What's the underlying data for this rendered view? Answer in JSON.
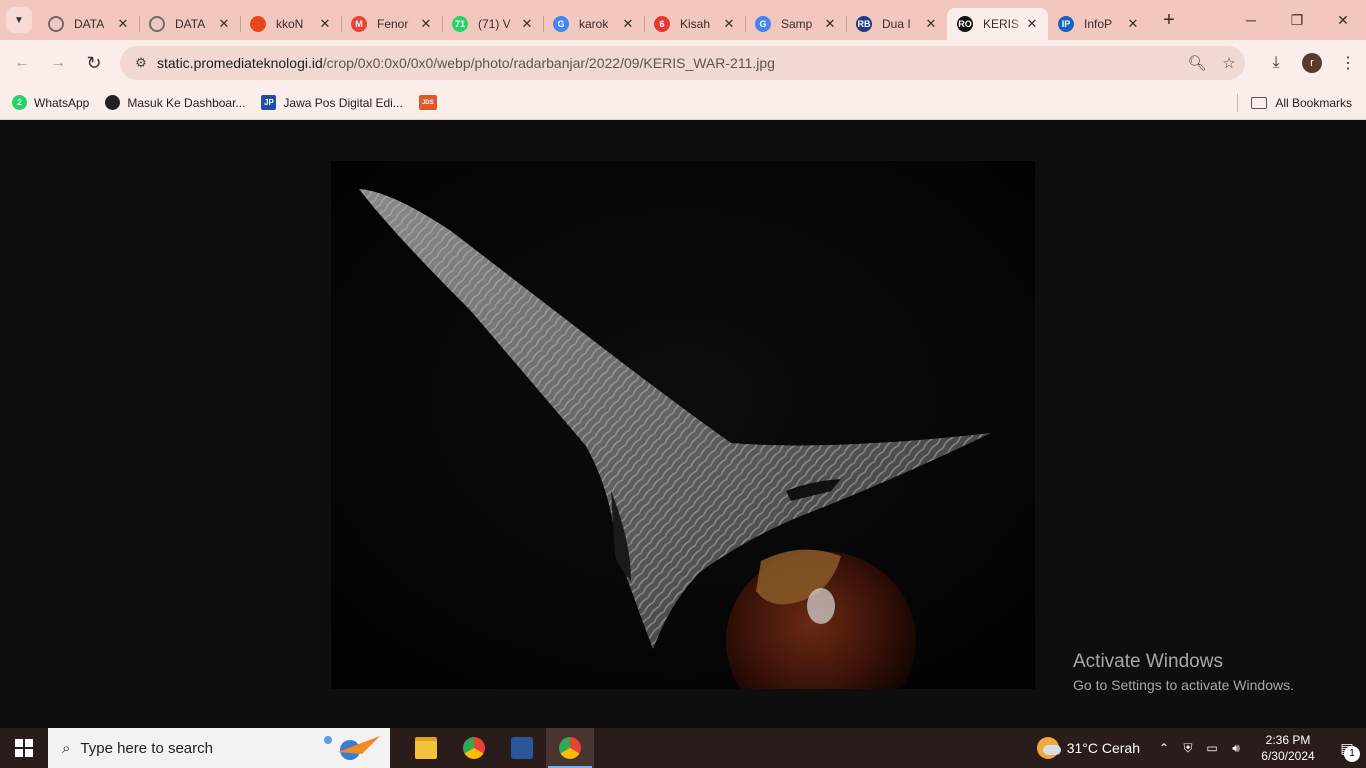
{
  "browser": {
    "tabs": [
      {
        "title": "DATA",
        "icon": "globe-icon",
        "color": "#6f6f6f",
        "glyph": ""
      },
      {
        "title": "DATA",
        "icon": "globe-icon",
        "color": "#6f6f6f",
        "glyph": ""
      },
      {
        "title": "kkoN",
        "icon": "flame-icon",
        "color": "#e64a19",
        "glyph": ""
      },
      {
        "title": "Fenor",
        "icon": "gmail-icon",
        "color": "#ea4335",
        "glyph": "M"
      },
      {
        "title": "(71) V",
        "icon": "whatsapp-icon",
        "color": "#25d366",
        "glyph": "71"
      },
      {
        "title": "karok",
        "icon": "google-icon",
        "color": "#4285f4",
        "glyph": "G"
      },
      {
        "title": "Kisah",
        "icon": "news-icon",
        "color": "#e53935",
        "glyph": "6"
      },
      {
        "title": "Samp",
        "icon": "google-icon",
        "color": "#4285f4",
        "glyph": "G"
      },
      {
        "title": "Dua I",
        "icon": "rb-icon",
        "color": "#1e3a8a",
        "glyph": "RB"
      },
      {
        "title": "KERIS",
        "icon": "ro-icon",
        "color": "#111111",
        "glyph": "RO",
        "active": true
      },
      {
        "title": "InfoP",
        "icon": "ip-icon",
        "color": "#1565c0",
        "glyph": "IP"
      }
    ],
    "url": {
      "domain": "static.promediateknologi.id",
      "path": "/crop/0x0:0x0/0x0/webp/photo/radarbanjar/2022/09/KERIS_WAR-211.jpg"
    },
    "profile_initial": "r",
    "bookmarks": [
      {
        "label": "WhatsApp",
        "icon": "whatsapp-icon",
        "color": "#25d366",
        "glyph": "2"
      },
      {
        "label": "Masuk Ke Dashboar...",
        "icon": "globe-icon",
        "color": "#222222",
        "glyph": ""
      },
      {
        "label": "Jawa Pos Digital Edi...",
        "icon": "jp-icon",
        "color": "#1e4fa3",
        "glyph": "JP"
      },
      {
        "label": "",
        "icon": "jds-icon",
        "color": "#e0592a",
        "glyph": "JDS"
      }
    ],
    "all_bookmarks": "All Bookmarks"
  },
  "watermark": {
    "line1": "Activate Windows",
    "line2": "Go to Settings to activate Windows."
  },
  "taskbar": {
    "search_placeholder": "Type here to search",
    "apps": [
      {
        "name": "file-explorer",
        "color": "#f3c13a"
      },
      {
        "name": "chrome",
        "color": "#4285f4"
      },
      {
        "name": "word",
        "color": "#2b579a"
      },
      {
        "name": "chrome-profile",
        "color": "#4285f4",
        "active": true
      }
    ],
    "weather": "31°C  Cerah",
    "time": "2:36 PM",
    "date": "6/30/2024",
    "notifications": "1"
  }
}
